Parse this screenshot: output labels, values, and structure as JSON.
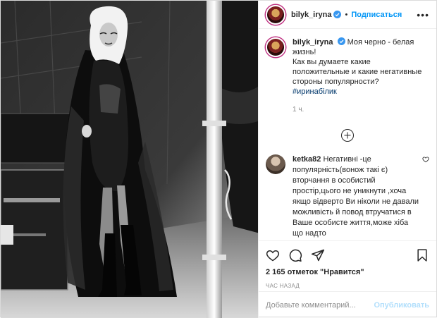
{
  "post": {
    "author": {
      "username": "bilyk_iryna",
      "verified": true,
      "follow_label": "Подписаться",
      "separator": "•"
    },
    "caption": {
      "username": "bilyk_iryna",
      "text": "Моя черно - белая жизнь!\nКак вы думаете какие положительные и какие негативные стороны популярности?",
      "hashtag": "#иринабілик",
      "time": "1 ч."
    },
    "comments": [
      {
        "username": "ketka82",
        "text": "Негативні -це популярність(вонож такі є) вторчання в особистий простір,цього не уникнути ,хоча якщо відверто Ви ніколи не давали можливість й повод втручатися в Ваше особисте життя,може хіба що надто"
      }
    ],
    "likes": "2 165 отметок \"Нравится\"",
    "timestamp": "час назад",
    "add_comment": {
      "placeholder": "Добавьте комментарий...",
      "publish_label": "Опубликовать"
    },
    "icons": {
      "header_more": "more-icon",
      "verified": "verified-badge-icon",
      "load_more": "plus-circle-icon",
      "comment_like": "heart-icon",
      "like": "heart-icon",
      "comment": "comment-icon",
      "share": "share-icon",
      "save": "bookmark-icon"
    },
    "colors": {
      "accent": "#0095f6",
      "hashtag": "#00376b",
      "muted": "#8e8e8e",
      "publish_disabled": "#b2dffc"
    }
  }
}
